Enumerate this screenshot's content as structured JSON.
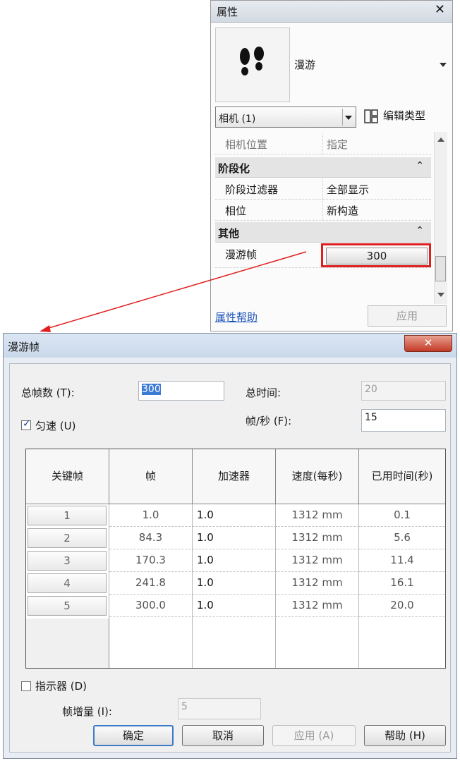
{
  "properties": {
    "title": "属性",
    "close_glyph": "✕",
    "type_name": "漫游",
    "type_icon": "footprints-icon",
    "selector_value": "相机 (1)",
    "edit_type_label": "编辑类型",
    "rows": [
      {
        "key": "相机位置",
        "value": "指定"
      }
    ],
    "groups": [
      {
        "name": "阶段化",
        "rows": [
          {
            "key": "阶段过滤器",
            "value": "全部显示"
          },
          {
            "key": "相位",
            "value": "新构造"
          }
        ]
      },
      {
        "name": "其他",
        "rows": [
          {
            "key": "漫游帧",
            "value": "300"
          }
        ]
      }
    ],
    "collapse_glyph": "≈",
    "help_link": "属性帮助",
    "apply_label": "应用"
  },
  "dialog": {
    "title": "漫游帧",
    "close_glyph": "✕",
    "total_frames_label": "总帧数 (T):",
    "total_frames_value": "300",
    "total_time_label": "总时间:",
    "total_time_value": "20",
    "uniform_speed_label": "匀速 (U)",
    "uniform_speed_checked": true,
    "fps_label": "帧/秒 (F):",
    "fps_value": "15",
    "table": {
      "headers": [
        "关键帧",
        "帧",
        "加速器",
        "速度(每秒)",
        "已用时间(秒)"
      ],
      "rows": [
        {
          "key": "1",
          "frame": "1.0",
          "accel": "1.0",
          "speed": "1312 mm",
          "elapsed": "0.1"
        },
        {
          "key": "2",
          "frame": "84.3",
          "accel": "1.0",
          "speed": "1312 mm",
          "elapsed": "5.6"
        },
        {
          "key": "3",
          "frame": "170.3",
          "accel": "1.0",
          "speed": "1312 mm",
          "elapsed": "11.4"
        },
        {
          "key": "4",
          "frame": "241.8",
          "accel": "1.0",
          "speed": "1312 mm",
          "elapsed": "16.1"
        },
        {
          "key": "5",
          "frame": "300.0",
          "accel": "1.0",
          "speed": "1312 mm",
          "elapsed": "20.0"
        }
      ]
    },
    "indicator_label": "指示器 (D)",
    "indicator_checked": false,
    "frame_increment_label": "帧增量 (I):",
    "frame_increment_value": "5",
    "buttons": {
      "ok": "确定",
      "cancel": "取消",
      "apply": "应用 (A)",
      "help": "帮助 (H)"
    }
  },
  "colors": {
    "highlight": "#e02020",
    "arrow": "#e02020",
    "link": "#1a4fb8"
  }
}
